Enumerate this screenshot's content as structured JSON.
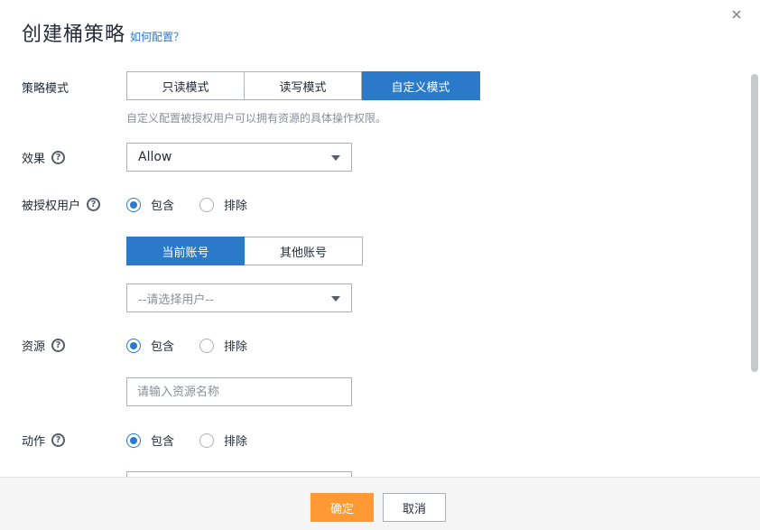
{
  "dialog": {
    "title": "创建桶策略",
    "help_link": "如何配置？",
    "close_icon": "close-icon"
  },
  "policy_mode": {
    "label": "策略模式",
    "options": [
      "只读模式",
      "读写模式",
      "自定义模式"
    ],
    "selected": "自定义模式",
    "hint": "自定义配置被授权用户可以拥有资源的具体操作权限。"
  },
  "effect": {
    "label": "效果",
    "help_icon": "question-icon",
    "value": "Allow"
  },
  "principal": {
    "label": "被授权用户",
    "help_icon": "question-icon",
    "radio_options": [
      "包含",
      "排除"
    ],
    "radio_selected": "包含",
    "account_tabs": [
      "当前账号",
      "其他账号"
    ],
    "account_selected": "当前账号",
    "user_select_placeholder": "--请选择用户--"
  },
  "resource": {
    "label": "资源",
    "help_icon": "question-icon",
    "radio_options": [
      "包含",
      "排除"
    ],
    "radio_selected": "包含",
    "input_placeholder": "请输入资源名称"
  },
  "action": {
    "label": "动作",
    "help_icon": "question-icon",
    "radio_options": [
      "包含",
      "排除"
    ],
    "radio_selected": "包含"
  },
  "footer": {
    "confirm": "确定",
    "cancel": "取消"
  },
  "colors": {
    "accent": "#2a7ac9",
    "primary_button": "#ff9933"
  }
}
